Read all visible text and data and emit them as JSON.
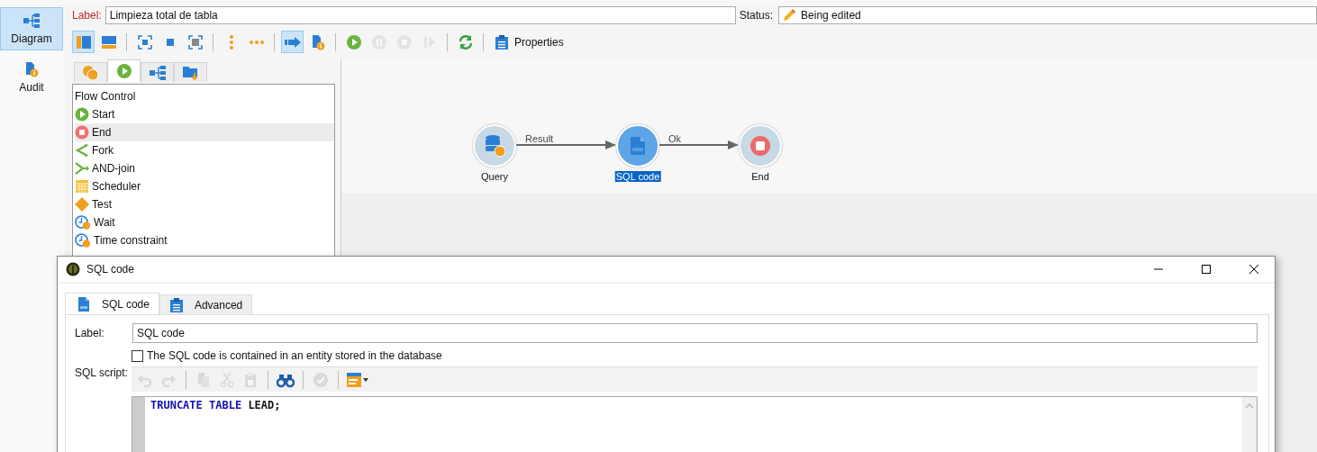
{
  "nav": [
    {
      "label": "Diagram",
      "selected": true
    },
    {
      "label": "Audit",
      "selected": false
    }
  ],
  "header": {
    "label_caption": "Label:",
    "label_value": "Limpieza total de tabla",
    "status_caption": "Status:",
    "status_value": "Being edited"
  },
  "toolbar": {
    "groups": [
      [
        {
          "pressed": true,
          "disabled": false
        },
        {
          "pressed": false,
          "disabled": false
        }
      ],
      [
        {
          "pressed": false,
          "disabled": false
        },
        {
          "pressed": false,
          "disabled": false
        },
        {
          "pressed": false,
          "disabled": false
        }
      ],
      [
        {
          "pressed": false,
          "disabled": false
        },
        {
          "pressed": false,
          "disabled": false
        }
      ],
      [
        {
          "pressed": true,
          "disabled": false
        },
        {
          "pressed": false,
          "disabled": false
        }
      ],
      [
        {
          "pressed": false,
          "disabled": false
        },
        {
          "pressed": false,
          "disabled": true
        },
        {
          "pressed": false,
          "disabled": true
        },
        {
          "pressed": false,
          "disabled": true
        }
      ],
      [
        {
          "pressed": false,
          "disabled": false
        }
      ]
    ],
    "properties_label": "Properties"
  },
  "palette": {
    "tabs": [
      {
        "selected": false
      },
      {
        "selected": true
      },
      {
        "selected": false
      },
      {
        "selected": false
      }
    ],
    "group": "Flow Control",
    "items": [
      {
        "label": "Start",
        "kind": "start",
        "selected": false
      },
      {
        "label": "End",
        "kind": "end",
        "selected": true
      },
      {
        "label": "Fork",
        "kind": "fork",
        "selected": false
      },
      {
        "label": "AND-join",
        "kind": "join",
        "selected": false
      },
      {
        "label": "Scheduler",
        "kind": "scheduler",
        "selected": false
      },
      {
        "label": "Test",
        "kind": "test",
        "selected": false
      },
      {
        "label": "Wait",
        "kind": "wait",
        "selected": false
      },
      {
        "label": "Time constraint",
        "kind": "wait",
        "selected": false
      }
    ]
  },
  "diagram": {
    "nodes": [
      {
        "label": "Query",
        "kind": "query",
        "selected": false
      },
      {
        "label": "SQL code",
        "kind": "sql",
        "selected": true
      },
      {
        "label": "End",
        "kind": "end",
        "selected": false
      }
    ],
    "edges": [
      {
        "label": "Result"
      },
      {
        "label": "Ok"
      }
    ]
  },
  "dialog": {
    "title": "SQL code",
    "tabs": [
      {
        "label": "SQL code",
        "selected": true
      },
      {
        "label": "Advanced",
        "selected": false
      }
    ],
    "label_caption": "Label:",
    "label_value": "SQL code",
    "checkbox": {
      "label": "The SQL code is contained in an entity stored in the database",
      "checked": false
    },
    "script_caption": "SQL script:",
    "script_toolbar": [
      [
        {
          "disabled": true
        },
        {
          "disabled": true
        }
      ],
      [
        {
          "disabled": true
        },
        {
          "disabled": true
        },
        {
          "disabled": true
        }
      ],
      [
        {
          "disabled": false
        }
      ],
      [
        {
          "disabled": true
        }
      ],
      [
        {
          "disabled": false
        }
      ]
    ],
    "code": [
      {
        "text": "TRUNCATE",
        "kind": "keyword"
      },
      {
        "text": "TABLE",
        "kind": "keyword"
      },
      {
        "text": "LEAD;",
        "kind": "plain"
      }
    ]
  }
}
